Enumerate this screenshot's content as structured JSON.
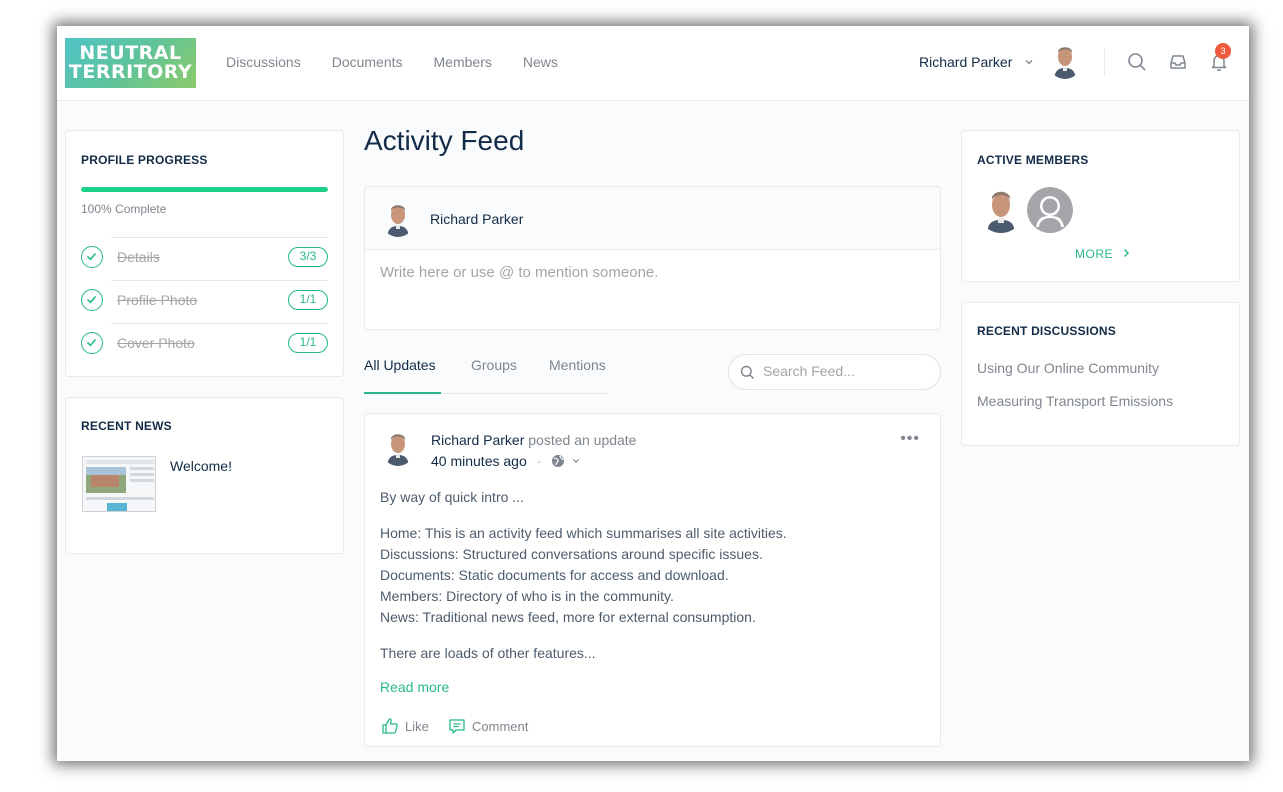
{
  "brand": {
    "logo_line1": "NEUTRAL",
    "logo_line2": "TERRITORY"
  },
  "nav": {
    "items": [
      {
        "label": "Discussions"
      },
      {
        "label": "Documents"
      },
      {
        "label": "Members"
      },
      {
        "label": "News"
      }
    ]
  },
  "user": {
    "name": "Richard Parker"
  },
  "notifications": {
    "count": "3"
  },
  "profile_progress": {
    "title": "PROFILE PROGRESS",
    "percent": 100,
    "label": "100% Complete",
    "steps": [
      {
        "label": "Details",
        "count": "3/3"
      },
      {
        "label": "Profile Photo",
        "count": "1/1"
      },
      {
        "label": "Cover Photo",
        "count": "1/1"
      }
    ]
  },
  "recent_news": {
    "title": "RECENT NEWS",
    "items": [
      {
        "title": "Welcome!"
      }
    ]
  },
  "feed": {
    "title": "Activity Feed",
    "composer": {
      "author": "Richard Parker",
      "placeholder": "Write here or use @ to mention someone."
    },
    "tabs": [
      {
        "label": "All Updates"
      },
      {
        "label": "Groups"
      },
      {
        "label": "Mentions"
      }
    ],
    "search_placeholder": "Search Feed...",
    "post": {
      "author": "Richard Parker",
      "action": "posted an update",
      "time": "40 minutes ago",
      "intro": "By way of quick intro ...",
      "lines": [
        "Home: This is an activity feed which summarises all site activities.",
        "Discussions: Structured conversations around specific issues.",
        "Documents: Static documents for access and download.",
        "Members: Directory of who is in the community.",
        "News: Traditional news feed, more for external consumption."
      ],
      "outro": "There are loads of other features...",
      "read_more": "Read more",
      "like_label": "Like",
      "comment_label": "Comment"
    }
  },
  "active_members": {
    "title": "ACTIVE MEMBERS",
    "more_label": "MORE"
  },
  "recent_discussions": {
    "title": "RECENT DISCUSSIONS",
    "items": [
      {
        "title": "Using Our Online Community"
      },
      {
        "title": "Measuring Transport Emissions"
      }
    ]
  },
  "colors": {
    "accent": "#27b88e",
    "progress": "#1cd28b",
    "badge": "#ef5a3c",
    "text": "#122b46",
    "muted": "#7f868f"
  }
}
